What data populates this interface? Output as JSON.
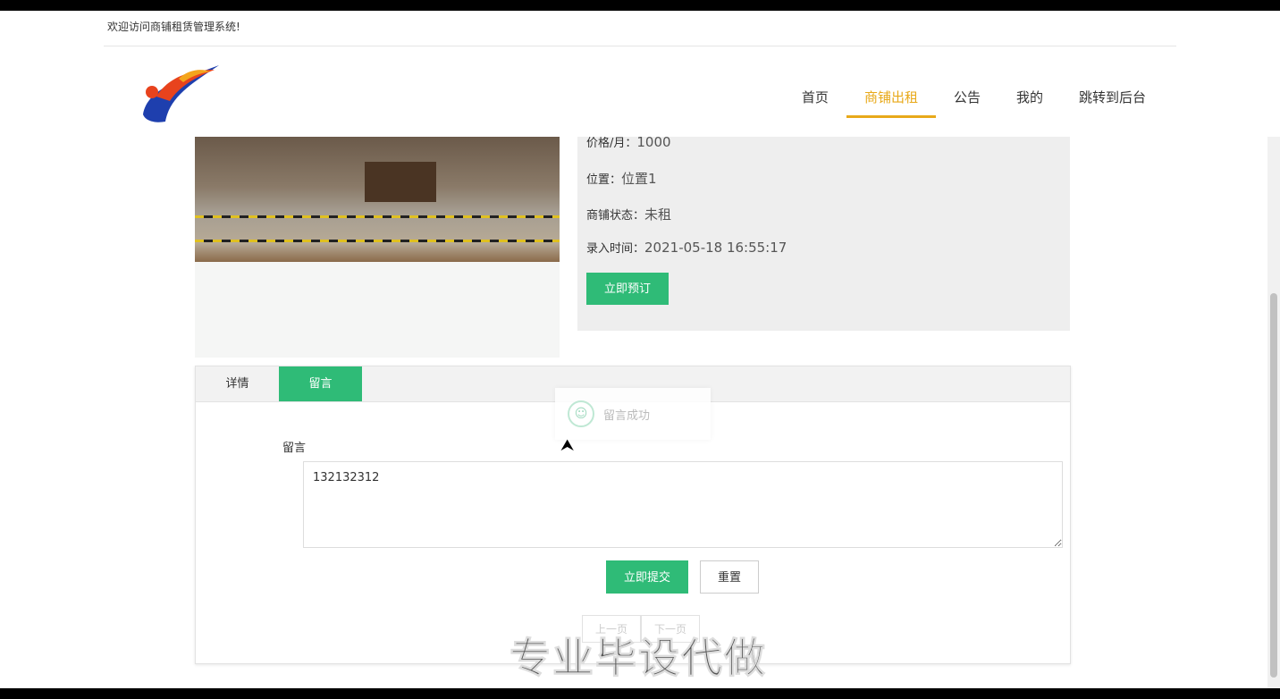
{
  "header": {
    "welcome": "欢迎访问商铺租赁管理系统!",
    "nav": [
      {
        "label": "首页"
      },
      {
        "label": "商铺出租"
      },
      {
        "label": "公告"
      },
      {
        "label": "我的"
      },
      {
        "label": "跳转到后台"
      }
    ]
  },
  "shop": {
    "price_label": "价格/月：",
    "price": "1000",
    "location_label": "位置：",
    "location": "位置1",
    "status_label": "商铺状态：",
    "status": "未租",
    "time_label": "录入时间：",
    "time": "2021-05-18 16:55:17",
    "book_button": "立即预订"
  },
  "tabs": [
    {
      "label": "详情"
    },
    {
      "label": "留言"
    }
  ],
  "message": {
    "label": "留言",
    "value": "132132312",
    "submit": "立即提交",
    "reset": "重置"
  },
  "pager": {
    "prev": "上一页",
    "next": "下一页"
  },
  "toast": {
    "text": "留言成功"
  },
  "watermark": "专业毕设代做",
  "colors": {
    "accent": "#2fbb77",
    "nav_active": "#e8a91a"
  }
}
